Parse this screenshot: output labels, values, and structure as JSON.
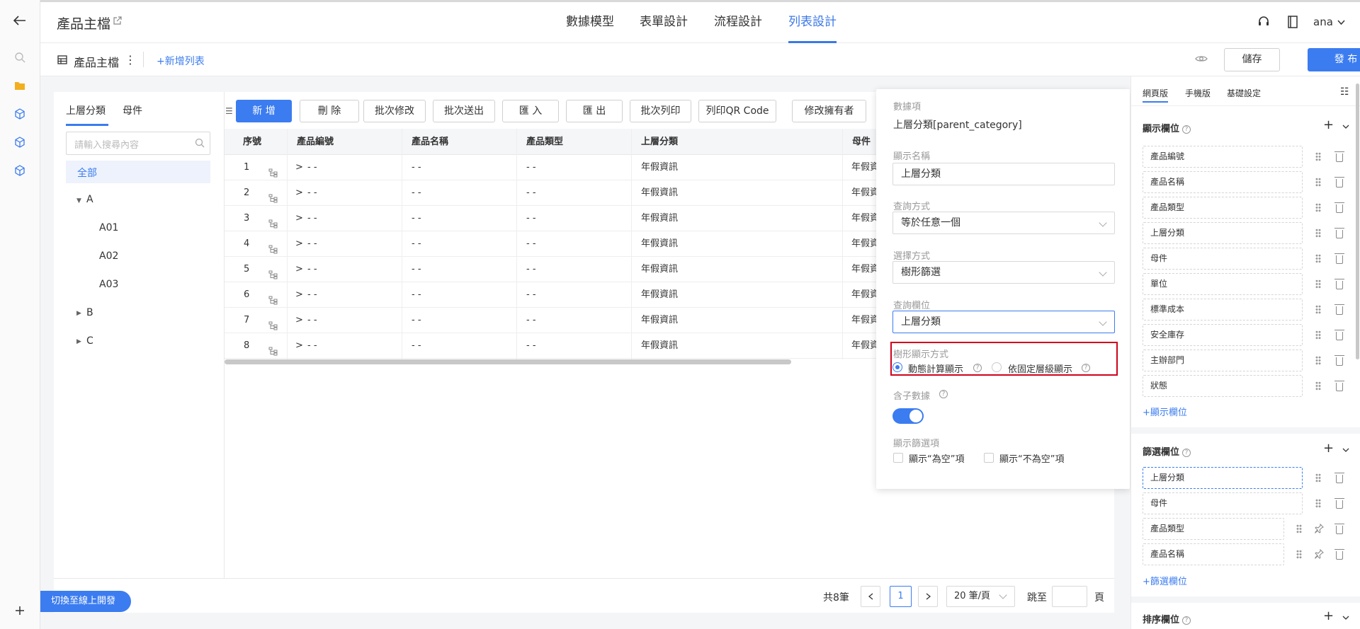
{
  "header": {
    "title": "產品主檔",
    "nav_tabs": [
      "數據模型",
      "表單設計",
      "流程設計",
      "列表設計"
    ],
    "user": "ana"
  },
  "subbar": {
    "list_name": "產品主檔",
    "add_list": "+新增列表",
    "save": "儲存",
    "publish": "發 布"
  },
  "left_panel": {
    "tabs": [
      "上層分類",
      "母件"
    ],
    "search_placeholder": "請輸入搜尋內容",
    "tree": {
      "all": "全部",
      "a": "A",
      "a01": "A01",
      "a02": "A02",
      "a03": "A03",
      "b": "B",
      "c": "C"
    }
  },
  "toolbar": {
    "buttons": [
      "新 增",
      "刪 除",
      "批次修改",
      "批次送出",
      "匯 入",
      "匯 出",
      "批次列印",
      "列印QR Code",
      "修改擁有者"
    ]
  },
  "table": {
    "headers": [
      "序號",
      "產品編號",
      "產品名稱",
      "產品類型",
      "上層分類",
      "母件"
    ],
    "rows": [
      {
        "no": "1",
        "code": "- -",
        "name": "- -",
        "type": "- -",
        "parent": "年假資訊",
        "mother": "年假資"
      },
      {
        "no": "2",
        "code": "- -",
        "name": "- -",
        "type": "- -",
        "parent": "年假資訊",
        "mother": "年假資"
      },
      {
        "no": "3",
        "code": "- -",
        "name": "- -",
        "type": "- -",
        "parent": "年假資訊",
        "mother": "年假資"
      },
      {
        "no": "4",
        "code": "- -",
        "name": "- -",
        "type": "- -",
        "parent": "年假資訊",
        "mother": "年假資"
      },
      {
        "no": "5",
        "code": "- -",
        "name": "- -",
        "type": "- -",
        "parent": "年假資訊",
        "mother": "年假資"
      },
      {
        "no": "6",
        "code": "- -",
        "name": "- -",
        "type": "- -",
        "parent": "年假資訊",
        "mother": "年假資"
      },
      {
        "no": "7",
        "code": "- -",
        "name": "- -",
        "type": "- -",
        "parent": "年假資訊",
        "mother": "年假資"
      },
      {
        "no": "8",
        "code": "- -",
        "name": "- -",
        "type": "- -",
        "parent": "年假資訊",
        "mother": "年假資"
      }
    ]
  },
  "pagination": {
    "total": "共8筆",
    "current_page": "1",
    "page_size": "20 筆/頁",
    "goto": "跳至",
    "page_unit": "頁"
  },
  "switch_btn": "切換至線上開發",
  "popup": {
    "data_item_label": "數據項",
    "data_item_value": "上層分類[parent_category]",
    "display_name_label": "顯示名稱",
    "display_name_value": "上層分類",
    "query_method_label": "查詢方式",
    "query_method_value": "等於任意一個",
    "select_method_label": "選擇方式",
    "select_method_value": "樹形篩選",
    "query_field_label": "查詢欄位",
    "query_field_value": "上層分類",
    "tree_display_label": "樹形顯示方式",
    "radio_dynamic": "動態計算顯示",
    "radio_fixed": "依固定層級顯示",
    "include_children_label": "含子數據",
    "include_children_on": true,
    "show_filter_label": "顯示篩選項",
    "cb_empty": "顯示“為空”項",
    "cb_not_empty": "顯示“不為空”項"
  },
  "right_panel": {
    "tabs": [
      "網頁版",
      "手機版",
      "基礎設定"
    ],
    "display_fields_title": "顯示欄位",
    "display_fields": [
      "產品編號",
      "產品名稱",
      "產品類型",
      "上層分類",
      "母件",
      "單位",
      "標準成本",
      "安全庫存",
      "主辦部門",
      "狀態"
    ],
    "add_display_field": "+顯示欄位",
    "filter_fields_title": "篩選欄位",
    "filter_fields": [
      "上層分類",
      "母件",
      "產品類型",
      "產品名稱"
    ],
    "add_filter_field": "+篩選欄位",
    "sort_fields_title": "排序欄位"
  },
  "colors": {
    "accent": "#3b7cf0",
    "highlight_box": "#d0021b"
  }
}
